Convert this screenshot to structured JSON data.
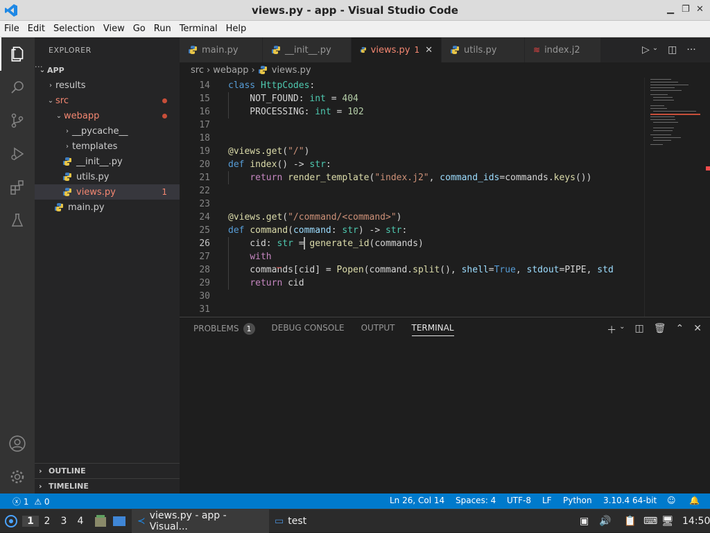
{
  "window": {
    "title": "views.py - app - Visual Studio Code"
  },
  "menu": [
    "File",
    "Edit",
    "Selection",
    "View",
    "Go",
    "Run",
    "Terminal",
    "Help"
  ],
  "sidebar": {
    "title": "EXPLORER",
    "root": "APP",
    "tree": [
      {
        "label": "results",
        "indent": 1,
        "chevron": "›",
        "color": "normal"
      },
      {
        "label": "src",
        "indent": 1,
        "chevron": "⌄",
        "color": "red",
        "dot": true
      },
      {
        "label": "webapp",
        "indent": 2,
        "chevron": "⌄",
        "color": "red",
        "dot": true
      },
      {
        "label": "__pycache__",
        "indent": 3,
        "chevron": "›",
        "color": "normal"
      },
      {
        "label": "templates",
        "indent": 3,
        "chevron": "›",
        "color": "normal"
      },
      {
        "label": "__init__.py",
        "indent": 3,
        "icon": "python-icon",
        "color": "normal"
      },
      {
        "label": "utils.py",
        "indent": 3,
        "icon": "python-icon",
        "color": "normal"
      },
      {
        "label": "views.py",
        "indent": 3,
        "icon": "python-icon",
        "color": "red",
        "badge": "1",
        "selected": true
      },
      {
        "label": "main.py",
        "indent": 2,
        "icon": "python-icon",
        "color": "normal"
      }
    ],
    "outline": "OUTLINE",
    "timeline": "TIMELINE"
  },
  "tabs": [
    {
      "label": "main.py",
      "icon": "python-icon"
    },
    {
      "label": "__init__.py",
      "icon": "python-icon"
    },
    {
      "label": "views.py",
      "icon": "python-icon",
      "active": true,
      "badge": "1"
    },
    {
      "label": "utils.py",
      "icon": "python-icon"
    },
    {
      "label": "index.j2",
      "icon": "jinja-icon"
    }
  ],
  "breadcrumb": [
    "src",
    "webapp",
    "views.py"
  ],
  "editor": {
    "current_line": "26",
    "lines": [
      {
        "n": "14",
        "tokens": [
          [
            "kw",
            "class"
          ],
          [
            "t",
            " "
          ],
          [
            "cls",
            "HttpCodes"
          ],
          [
            "t",
            ":"
          ]
        ]
      },
      {
        "n": "15",
        "tokens": [
          [
            "t",
            "    NOT_FOUND: "
          ],
          [
            "cls",
            "int"
          ],
          [
            "t",
            " = "
          ],
          [
            "num",
            "404"
          ]
        ]
      },
      {
        "n": "16",
        "tokens": [
          [
            "t",
            "    PROCESSING: "
          ],
          [
            "cls",
            "int"
          ],
          [
            "t",
            " = "
          ],
          [
            "num",
            "102"
          ]
        ]
      },
      {
        "n": "17",
        "tokens": []
      },
      {
        "n": "18",
        "tokens": []
      },
      {
        "n": "19",
        "tokens": [
          [
            "fn",
            "@views.get"
          ],
          [
            "t",
            "("
          ],
          [
            "str",
            "\"/\""
          ],
          [
            "t",
            ")"
          ]
        ]
      },
      {
        "n": "20",
        "tokens": [
          [
            "kw",
            "def"
          ],
          [
            "t",
            " "
          ],
          [
            "fn",
            "index"
          ],
          [
            "t",
            "() -> "
          ],
          [
            "cls",
            "str"
          ],
          [
            "t",
            ":"
          ]
        ]
      },
      {
        "n": "21",
        "tokens": [
          [
            "t",
            "    "
          ],
          [
            "ctl",
            "return"
          ],
          [
            "t",
            " "
          ],
          [
            "fn",
            "render_template"
          ],
          [
            "t",
            "("
          ],
          [
            "str",
            "\"index.j2\""
          ],
          [
            "t",
            ", "
          ],
          [
            "var",
            "command_ids"
          ],
          [
            "t",
            "=commands."
          ],
          [
            "fn",
            "keys"
          ],
          [
            "t",
            "())"
          ]
        ]
      },
      {
        "n": "22",
        "tokens": []
      },
      {
        "n": "23",
        "tokens": []
      },
      {
        "n": "24",
        "tokens": [
          [
            "fn",
            "@views.get"
          ],
          [
            "t",
            "("
          ],
          [
            "str",
            "\"/command/<command>\""
          ],
          [
            "t",
            ")"
          ]
        ]
      },
      {
        "n": "25",
        "tokens": [
          [
            "kw",
            "def"
          ],
          [
            "t",
            " "
          ],
          [
            "fn",
            "command"
          ],
          [
            "t",
            "("
          ],
          [
            "var",
            "command"
          ],
          [
            "t",
            ": "
          ],
          [
            "cls",
            "str"
          ],
          [
            "t",
            ") -> "
          ],
          [
            "cls",
            "str"
          ],
          [
            "t",
            ":"
          ]
        ]
      },
      {
        "n": "26",
        "tokens": [
          [
            "t",
            "    cid: "
          ],
          [
            "cls",
            "str"
          ],
          [
            "t",
            " = "
          ],
          [
            "fn",
            "generate_id"
          ],
          [
            "t",
            "(commands)"
          ]
        ]
      },
      {
        "n": "27",
        "tokens": [
          [
            "t",
            "    "
          ],
          [
            "ctl",
            "with"
          ]
        ]
      },
      {
        "n": "28",
        "tokens": [
          [
            "t",
            "    commands[cid] = "
          ],
          [
            "fn",
            "Popen"
          ],
          [
            "t",
            "(command."
          ],
          [
            "fn",
            "split"
          ],
          [
            "t",
            "(), "
          ],
          [
            "var",
            "shell"
          ],
          [
            "t",
            "="
          ],
          [
            "kw",
            "True"
          ],
          [
            "t",
            ", "
          ],
          [
            "var",
            "stdout"
          ],
          [
            "t",
            "=PIPE, "
          ],
          [
            "var",
            "std"
          ]
        ]
      },
      {
        "n": "29",
        "tokens": [
          [
            "t",
            "    "
          ],
          [
            "ctl",
            "return"
          ],
          [
            "t",
            " cid"
          ]
        ]
      },
      {
        "n": "30",
        "tokens": []
      },
      {
        "n": "31",
        "tokens": []
      }
    ]
  },
  "panel": {
    "tabs": [
      {
        "label": "PROBLEMS",
        "badge": "1"
      },
      {
        "label": "DEBUG CONSOLE"
      },
      {
        "label": "OUTPUT"
      },
      {
        "label": "TERMINAL",
        "active": true
      }
    ]
  },
  "status": {
    "errors": "1",
    "warnings": "0",
    "position": "Ln 26, Col 14",
    "spaces": "Spaces: 4",
    "encoding": "UTF-8",
    "eol": "LF",
    "language": "Python",
    "interpreter": "3.10.4 64-bit"
  },
  "taskbar": {
    "workspaces": [
      "1",
      "2",
      "3",
      "4"
    ],
    "apps": [
      {
        "label": "views.py - app - Visual...",
        "icon": "vscode-icon"
      },
      {
        "label": "test",
        "icon": "folder-icon"
      }
    ],
    "clock": "14:50"
  },
  "colors": {
    "accent": "#007acc",
    "error": "#f48771",
    "bg": "#1e1e1e"
  }
}
